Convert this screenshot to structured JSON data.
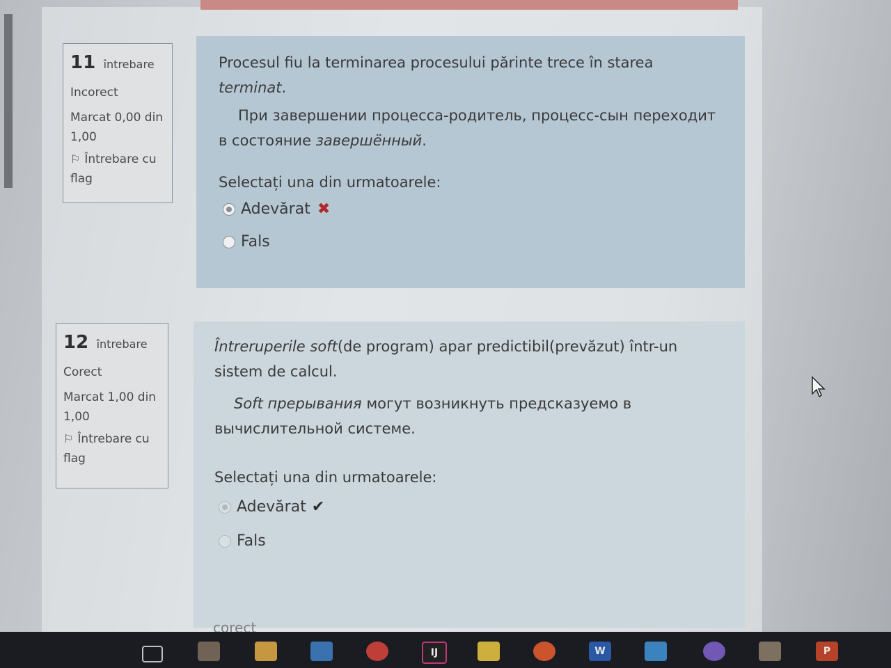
{
  "question11": {
    "number": "11",
    "word": "întrebare",
    "status": "Incorect",
    "mark": "Marcat 0,00 din 1,00",
    "flag": "Întrebare cu flag",
    "text_ro_part1": "Procesul fiu la terminarea procesului părinte trece  în starea",
    "text_ro_italic": "terminat",
    "text_ro_end": ".",
    "text_ru_part1": "При завершении процесса-родитель, процесс-сын переходит в состояние",
    "text_ru_italic": "завершённый",
    "text_ru_end": ".",
    "prompt": "Selectați una din urmatoarele:",
    "options": [
      "Adevărat",
      "Fals"
    ],
    "selected": "Adevărat",
    "result_icon": "x-icon"
  },
  "question12": {
    "number": "12",
    "word": "întrebare",
    "status": "Corect",
    "mark": "Marcat 1,00 din 1,00",
    "flag": "Întrebare cu flag",
    "text_ro_italic": "Întreruperile soft",
    "text_ro_part1": "(de program) apar predictibil(prevăzut) într-un sistem de calcul.",
    "text_ru_italic": "Soft прерывания",
    "text_ru_part1": " могут возникнуть предсказуемо в вычислительной системе.",
    "prompt": "Selectați una din urmatoarele:",
    "options": [
      "Adevărat",
      "Fals"
    ],
    "selected": "Adevărat",
    "result_icon": "check-icon"
  },
  "footer_text": "corect",
  "colors": {
    "incorrect": "#b32727",
    "panel11": "#b6c7d4",
    "panel12": "#cbd6dd",
    "taskbar": "#1a1c22"
  },
  "taskbar_icons": [
    "task-view-icon",
    "chart-icon",
    "folder-icon",
    "mail-icon",
    "chrome-icon",
    "intellij-icon",
    "notes-icon",
    "ubuntu-icon",
    "word-icon",
    "camera-icon",
    "viber-icon",
    "sticky-icon",
    "powerpoint-icon"
  ],
  "taskbar_labels": {
    "intellij": "IJ",
    "word": "W",
    "powerpoint": "P"
  }
}
